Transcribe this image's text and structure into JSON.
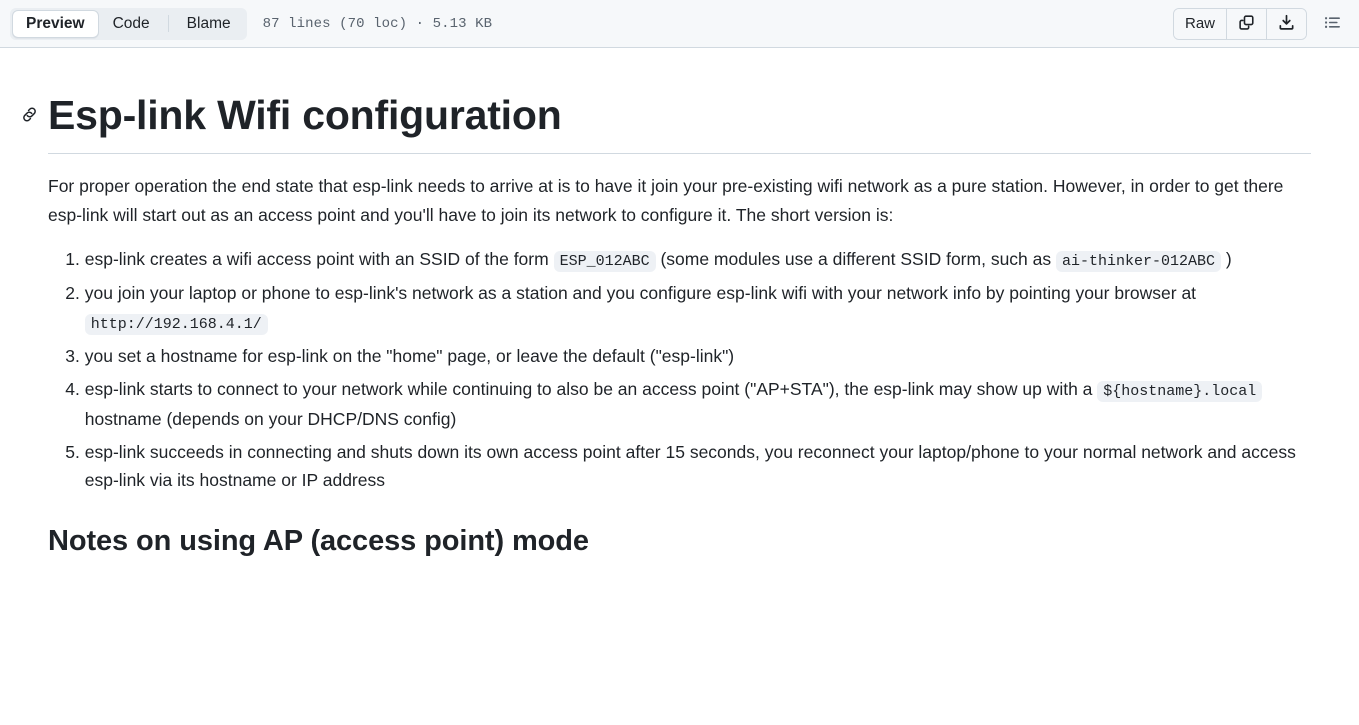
{
  "header": {
    "tabs": [
      {
        "label": "Preview",
        "selected": true
      },
      {
        "label": "Code",
        "selected": false
      },
      {
        "label": "Blame",
        "selected": false
      }
    ],
    "file_meta": "87 lines (70 loc) · 5.13 KB",
    "raw_label": "Raw",
    "copy_icon": "copy-icon",
    "download_icon": "download-icon",
    "outline_icon": "outline-list-icon"
  },
  "document": {
    "heading": "Esp-link Wifi configuration",
    "anchor_icon": "link-icon",
    "intro": "For proper operation the end state that esp-link needs to arrive at is to have it join your pre-existing wifi network as a pure station. However, in order to get there esp-link will start out as an access point and you'll have to join its network to configure it. The short version is:",
    "steps": [
      {
        "pre": "esp-link creates a wifi access point with an SSID of the form ",
        "code1": "ESP_012ABC",
        "mid": " (some modules use a different SSID form, such as ",
        "code2": "ai-thinker-012ABC",
        "post": " )"
      },
      {
        "pre": "you join your laptop or phone to esp-link's network as a station and you configure esp-link wifi with your network info by pointing your browser at ",
        "code1": "http://192.168.4.1/",
        "mid": "",
        "code2": "",
        "post": ""
      },
      {
        "pre": "you set a hostname for esp-link on the \"home\" page, or leave the default (\"esp-link\")",
        "code1": "",
        "mid": "",
        "code2": "",
        "post": ""
      },
      {
        "pre": "esp-link starts to connect to your network while continuing to also be an access point (\"AP+STA\"), the esp-link may show up with a ",
        "code1": "${hostname}.local",
        "mid": "",
        "code2": "",
        "post": " hostname (depends on your DHCP/DNS config)"
      },
      {
        "pre": "esp-link succeeds in connecting and shuts down its own access point after 15 seconds, you reconnect your laptop/phone to your normal network and access esp-link via its hostname or IP address",
        "code1": "",
        "mid": "",
        "code2": "",
        "post": ""
      }
    ],
    "section_heading": "Notes on using AP (access point) mode"
  },
  "colors": {
    "header_bg": "#f6f8fa",
    "border": "#d1d9e0",
    "text": "#1f2328",
    "muted": "#59636e",
    "code_bg": "#eaeef2"
  }
}
